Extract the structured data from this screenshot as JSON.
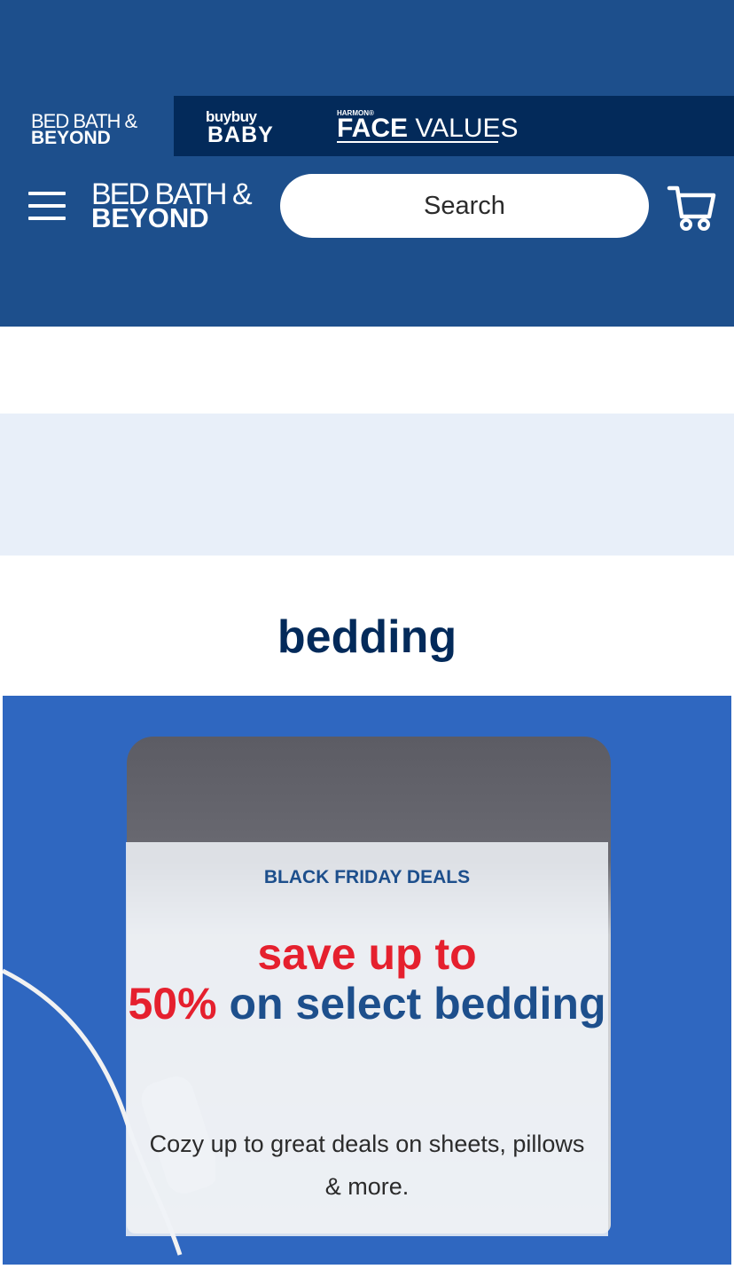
{
  "brand_bar": {
    "bbb": {
      "line1": "BED BATH &",
      "line2": "BEYOND"
    },
    "buybuy_baby": {
      "line1": "buybuy",
      "line2": "BABY"
    },
    "face_values": {
      "small": "HARMON®",
      "bold": "FACE",
      "rest": " VALUES"
    }
  },
  "header": {
    "logo": {
      "line1": "BED BATH &",
      "line2": "BEYOND"
    },
    "search": {
      "placeholder": "Search"
    }
  },
  "section": {
    "title": "bedding"
  },
  "promo": {
    "eyebrow": "BLACK FRIDAY DEALS",
    "headline_red_1": "save up to",
    "headline_red_2": "50%",
    "headline_blue": " on select bedding",
    "body": "Cozy up to great deals on sheets, pillows & more."
  },
  "colors": {
    "header_bg": "#1d4f8c",
    "brand_bar_dark": "#032a5a",
    "band_bg": "#e8eff9",
    "accent_red": "#e5202e",
    "title_navy": "#032a5a"
  },
  "icons": [
    "menu-icon",
    "cart-icon"
  ]
}
